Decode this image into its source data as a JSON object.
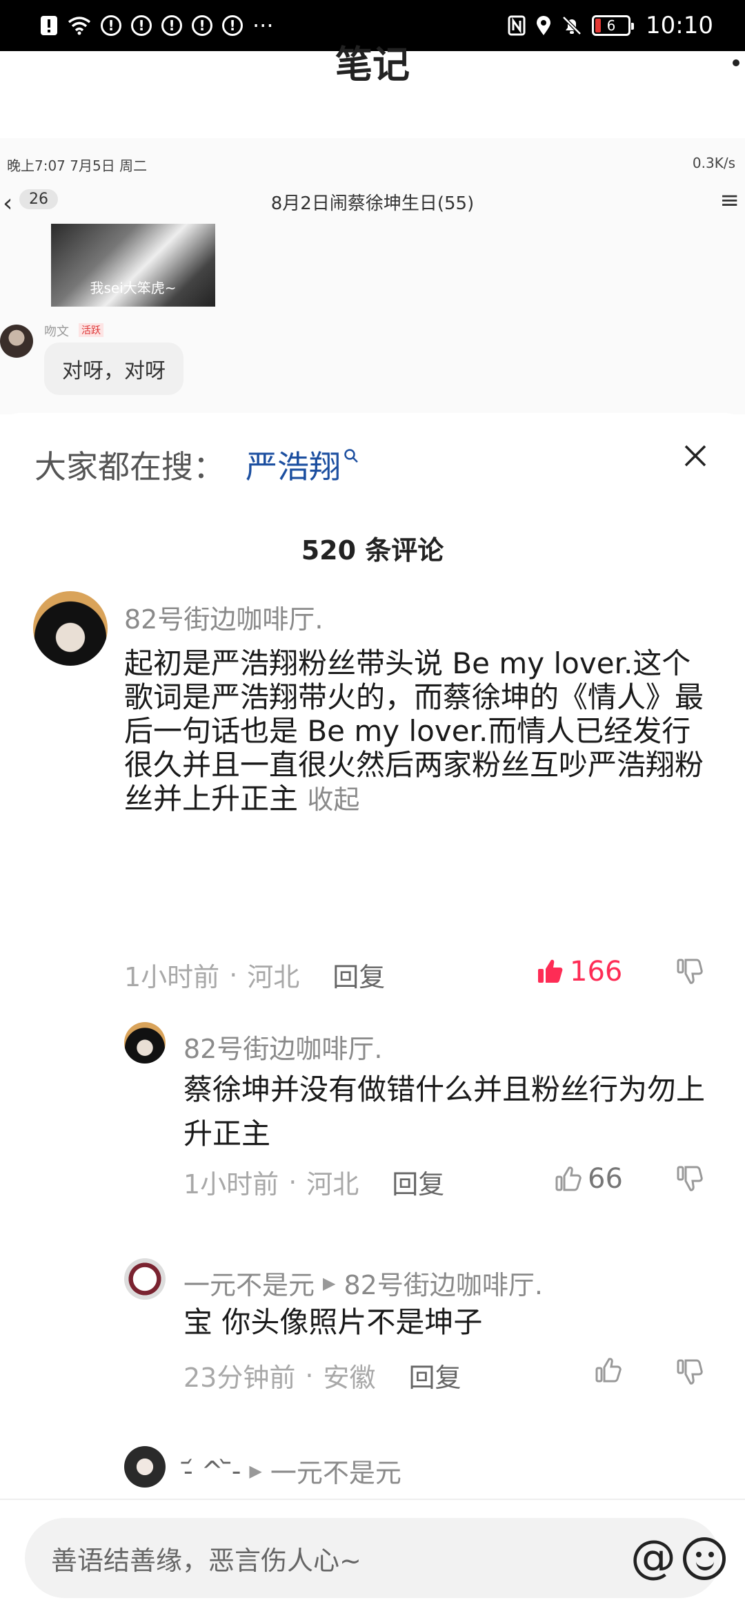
{
  "status_bar": {
    "left_icons": [
      "alert-icon",
      "wifi-icon",
      "notice-icon",
      "notice-icon",
      "notice-icon",
      "notice-icon",
      "notice-icon"
    ],
    "more": "···",
    "battery": "6",
    "time": "10:10"
  },
  "page": {
    "title": "笔记"
  },
  "embedded_screenshot": {
    "status_left": "晚上7:07  7月5日 周二",
    "status_right": "0.3K/s",
    "back_count": "26",
    "chat_title": "8月2日闹蔡徐坤生日(55)",
    "image_caption": "我sei大笨虎~",
    "sender_name": "吻文",
    "sender_tag": "活跃",
    "bubble_text": "对呀，对呀"
  },
  "sheet": {
    "search_prefix": "大家都在搜：",
    "search_term": "严浩翔",
    "close_symbol": "×",
    "comment_count": "520 条评论"
  },
  "comments": [
    {
      "username": "82号街边咖啡厅.",
      "content": "起初是严浩翔粉丝带头说 Be my lover.这个歌词是严浩翔带火的，而蔡徐坤的《情人》最后一句话也是 Be my lover.而情人已经发行很久并且一直很火然后两家粉丝互吵严浩翔粉丝并上升正主",
      "collapse_label": "收起",
      "time": "1小时前",
      "location": "河北",
      "reply_label": "回复",
      "likes": "166",
      "liked": true
    }
  ],
  "replies": [
    {
      "username": "82号街边咖啡厅.",
      "content": "蔡徐坤并没有做错什么并且粉丝行为勿上升正主",
      "time": "1小时前",
      "location": "河北",
      "reply_label": "回复",
      "likes": "66"
    },
    {
      "username": "一元不是元",
      "reply_to": "82号街边咖啡厅.",
      "content": "宝 你头像照片不是坤子",
      "time": "23分钟前",
      "location": "安徽",
      "reply_label": "回复",
      "likes": ""
    },
    {
      "username": "-᷄ ^ ᷅-",
      "reply_to": "一元不是元"
    }
  ],
  "input": {
    "placeholder": "善语结善缘，恶言伤人心~",
    "at_symbol": "@"
  },
  "colors": {
    "liked": "#fe2c55",
    "search_term": "#1c4fa0"
  }
}
